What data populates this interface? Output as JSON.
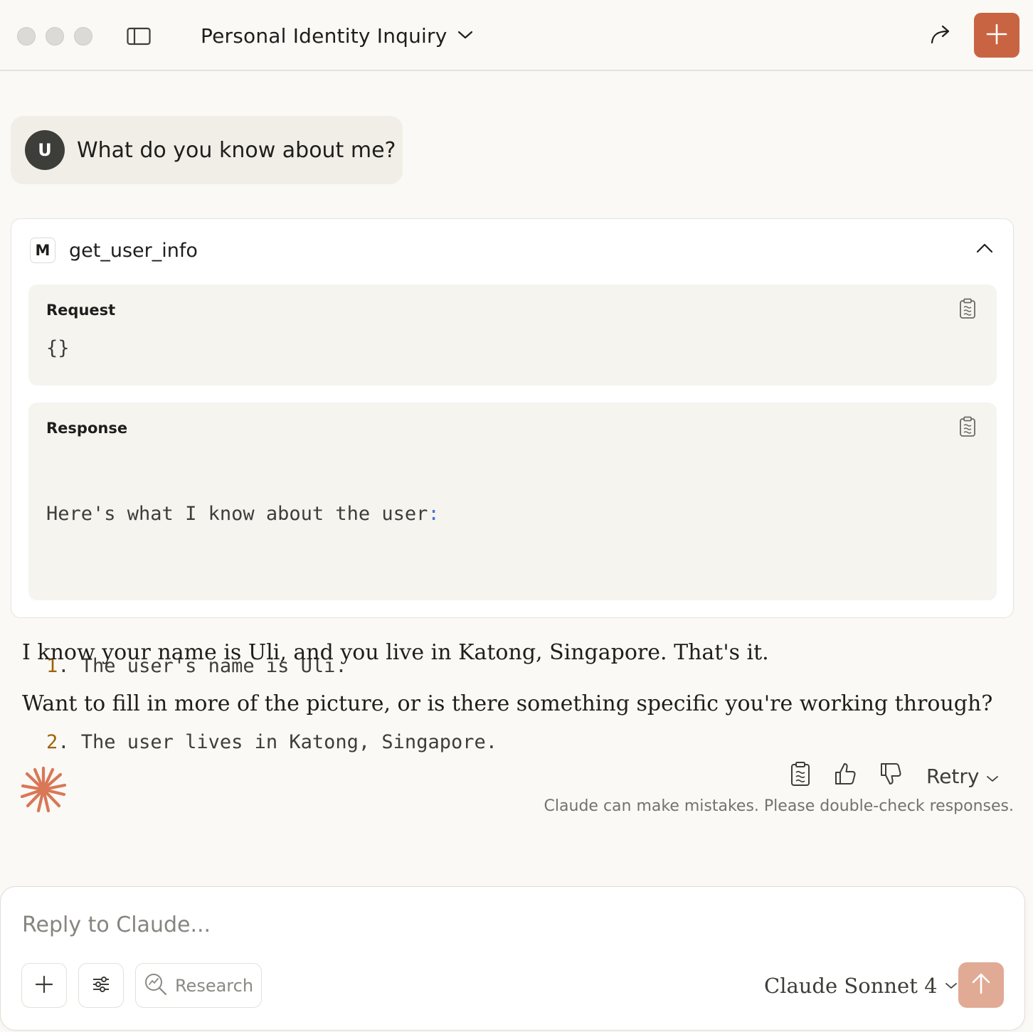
{
  "header": {
    "title": "Personal Identity Inquiry",
    "accent_color": "#c96442"
  },
  "user_message": {
    "avatar_initial": "U",
    "text": "What do you know about me?"
  },
  "tool_call": {
    "badge": "M",
    "name": "get_user_info",
    "request": {
      "label": "Request",
      "body": "{}"
    },
    "response": {
      "label": "Response",
      "intro": "Here's what I know about the user",
      "intro_colon": ":",
      "items": [
        {
          "num": "1",
          "text": " The user's name is Uli."
        },
        {
          "num": "2",
          "text": " The user lives in Katong, Singapore."
        }
      ]
    }
  },
  "assistant": {
    "paragraphs": [
      "I know your name is Uli, and you live in Katong, Singapore. That's it.",
      "Want to fill in more of the picture, or is there something specific you're working through?"
    ]
  },
  "actions": {
    "retry_label": "Retry",
    "disclaimer": "Claude can make mistakes. Please double-check responses."
  },
  "composer": {
    "placeholder": "Reply to Claude...",
    "research_label": "Research",
    "model_name": "Claude Sonnet 4",
    "send_color": "#e0aa95"
  }
}
